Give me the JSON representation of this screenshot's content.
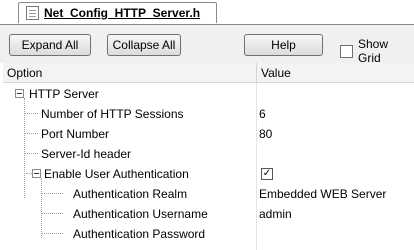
{
  "tab": {
    "title": "Net_Config_HTTP_Server.h"
  },
  "toolbar": {
    "expand_all": "Expand All",
    "collapse_all": "Collapse All",
    "help": "Help",
    "show_grid": "Show Grid",
    "show_grid_checked": false
  },
  "grid": {
    "columns": {
      "option": "Option",
      "value": "Value"
    },
    "rows": [
      {
        "label": "HTTP Server",
        "value": ""
      },
      {
        "label": "Number of HTTP Sessions",
        "value": "6"
      },
      {
        "label": "Port Number",
        "value": "80"
      },
      {
        "label": "Server-Id header",
        "value": ""
      },
      {
        "label": "Enable User Authentication",
        "value": "",
        "checked": true
      },
      {
        "label": "Authentication Realm",
        "value": "Embedded WEB Server"
      },
      {
        "label": "Authentication Username",
        "value": "admin"
      },
      {
        "label": "Authentication Password",
        "value": ""
      }
    ],
    "check_glyph": "✓"
  },
  "icons": {
    "file": "file-icon",
    "expander": "collapse-icon"
  }
}
